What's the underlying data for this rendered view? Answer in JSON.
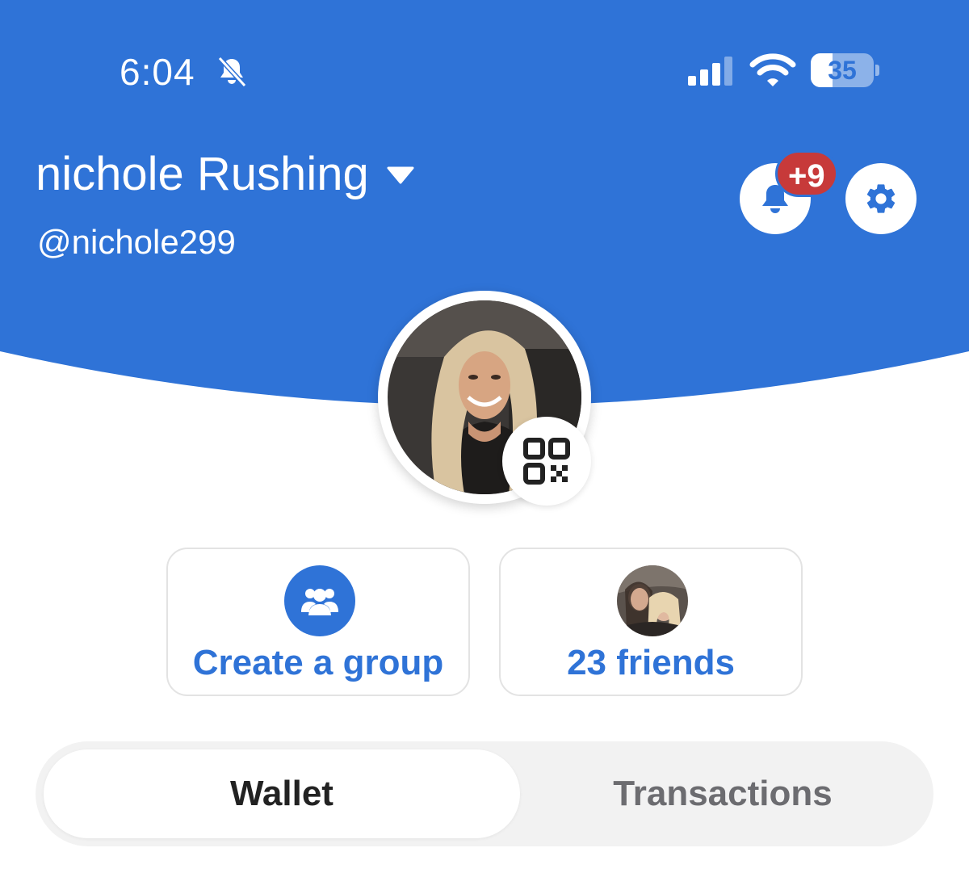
{
  "status_bar": {
    "time": "6:04",
    "battery_percent": "35",
    "battery_level": 0.35,
    "icons": [
      "bell-slash-icon",
      "cellular-signal-icon",
      "wifi-icon",
      "battery-icon"
    ]
  },
  "profile": {
    "name": "nichole Rushing",
    "username": "@nichole299",
    "notification_badge": "+9"
  },
  "cards": {
    "create_group_label": "Create a group",
    "friends_label": "23 friends"
  },
  "tabs": {
    "wallet_label": "Wallet",
    "transactions_label": "Transactions",
    "active": "Wallet"
  },
  "colors": {
    "brand_blue": "#2f73d7",
    "badge_red": "#c73a3a",
    "tab_active_text": "#222222",
    "tab_inactive_text": "#6c6c70"
  }
}
